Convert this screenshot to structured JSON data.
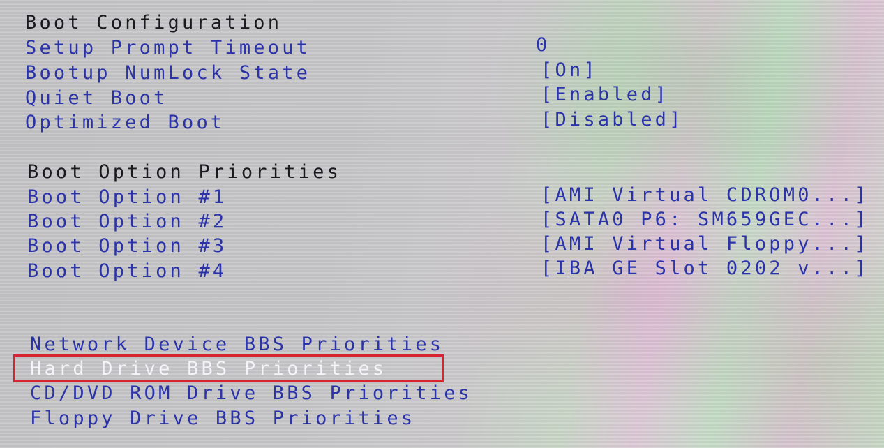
{
  "boot_configuration": {
    "header": "Boot Configuration",
    "items": [
      {
        "label": "Setup Prompt Timeout",
        "value": "0"
      },
      {
        "label": "Bootup NumLock State",
        "value": "[On]"
      },
      {
        "label": "Quiet Boot",
        "value": "[Enabled]"
      },
      {
        "label": "Optimized Boot",
        "value": "[Disabled]"
      }
    ]
  },
  "boot_option_priorities": {
    "header": "Boot Option Priorities",
    "items": [
      {
        "label": "Boot Option #1",
        "value": "[AMI Virtual CDROM0...]"
      },
      {
        "label": "Boot Option #2",
        "value": "[SATA0 P6: SM659GEC...]"
      },
      {
        "label": "Boot Option #3",
        "value": "[AMI Virtual Floppy...]"
      },
      {
        "label": "Boot Option #4",
        "value": "[IBA GE Slot 0202 v...]"
      }
    ]
  },
  "bbs_priorities": [
    {
      "label": "Network Device BBS Priorities"
    },
    {
      "label": "Hard Drive BBS Priorities",
      "selected": true
    },
    {
      "label": "CD/DVD ROM Drive BBS Priorities"
    },
    {
      "label": "Floppy Drive BBS Priorities"
    }
  ],
  "colors": {
    "item_text": "#2b33a8",
    "header_text": "#1a1a1e",
    "selected_text": "#f4f4f8",
    "highlight_border": "#d82430"
  }
}
